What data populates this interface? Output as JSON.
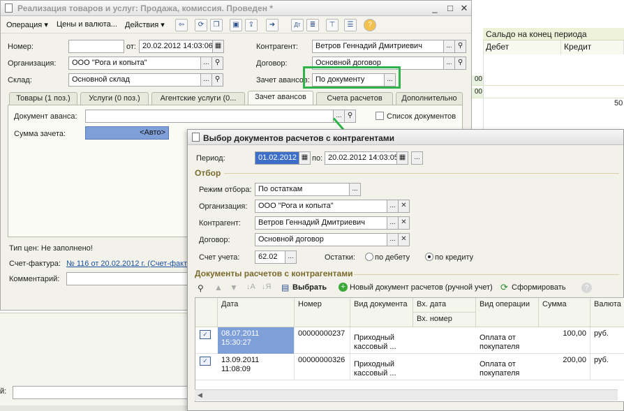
{
  "background_report": {
    "header": "Сальдо на конец периода",
    "col_debit": "Дебет",
    "col_credit": "Кредит",
    "row_values": [
      "00",
      "00"
    ],
    "cell_value": "50"
  },
  "main_window": {
    "title": "Реализация товаров и услуг: Продажа, комиссия. Проведен *",
    "toolbar": {
      "operation": "Операция",
      "prices": "Цены и валюта...",
      "actions": "Действия"
    },
    "number_label": "Номер:",
    "number_value": "",
    "date_label": "от:",
    "date_value": "20.02.2012 14:03:06",
    "counterparty_label": "Контрагент:",
    "counterparty_value": "Ветров Геннадий Дмитриевич",
    "org_label": "Организация:",
    "org_value": "ООО \"Рога и копыта\"",
    "contract_label": "Договор:",
    "contract_value": "Основной договор",
    "warehouse_label": "Склад:",
    "warehouse_value": "Основной склад",
    "advance_label": "Зачет авансов:",
    "advance_value": "По документу",
    "tabs": [
      "Товары (1 поз.)",
      "Услуги (0 поз.)",
      "Агентские услуги (0...",
      "Зачет авансов",
      "Счета расчетов",
      "Дополнительно"
    ],
    "advance_doc_label": "Документ аванса:",
    "list_docs_label": "Список документов",
    "offset_sum_label": "Сумма зачета:",
    "offset_sum_value": "<Авто>",
    "price_type": "Тип цен: Не заполнено!",
    "invoice_label": "Счет-фактура:",
    "invoice_value": "№ 116 от 20.02.2012 г. (Счет-факт",
    "comment_label": "Комментарий:",
    "bottom_label": "й:"
  },
  "dialog": {
    "title": "Выбор документов расчетов с контрагентами",
    "period_label": "Период:",
    "period_from": "01.02.2012",
    "period_to_label": "по:",
    "period_to": "20.02.2012 14:03:05",
    "filter_section": "Отбор",
    "mode_label": "Режим отбора:",
    "mode_value": "По остаткам",
    "org_label": "Организация:",
    "org_value": "ООО \"Рога и копыта\"",
    "counterparty_label": "Контрагент:",
    "counterparty_value": "Ветров Геннадий Дмитриевич",
    "contract_label": "Договор:",
    "contract_value": "Основной договор",
    "account_label": "Счет учета:",
    "account_value": "62.02",
    "balances_label": "Остатки:",
    "radio_debit": "по дебету",
    "radio_credit": "по кредиту",
    "docs_section": "Документы расчетов с контрагентами",
    "toolbar": {
      "select": "Выбрать",
      "new_doc": "Новый документ расчетов (ручной учет)",
      "form": "Сформировать"
    },
    "columns": [
      "Дата",
      "Номер",
      "Вид документа",
      "Вх. дата",
      "Вх. номер",
      "Вид операции",
      "Сумма",
      "Валюта"
    ],
    "rows": [
      {
        "date": "08.07.2011 15:30:27",
        "number": "00000000237",
        "doc_type_1": "Приходный",
        "doc_type_2": "кассовый ...",
        "op_1": "Оплата от",
        "op_2": "покупателя",
        "sum": "100,00",
        "currency": "руб."
      },
      {
        "date": "13.09.2011 11:08:09",
        "number": "00000000326",
        "doc_type_1": "Приходный",
        "doc_type_2": "кассовый ...",
        "op_1": "Оплата от",
        "op_2": "покупателя",
        "sum": "200,00",
        "currency": "руб."
      }
    ]
  },
  "colors": {
    "highlight_green": "#2db34a",
    "selected_cell": "#7f9fd9",
    "section_text": "#7a6a2c"
  }
}
